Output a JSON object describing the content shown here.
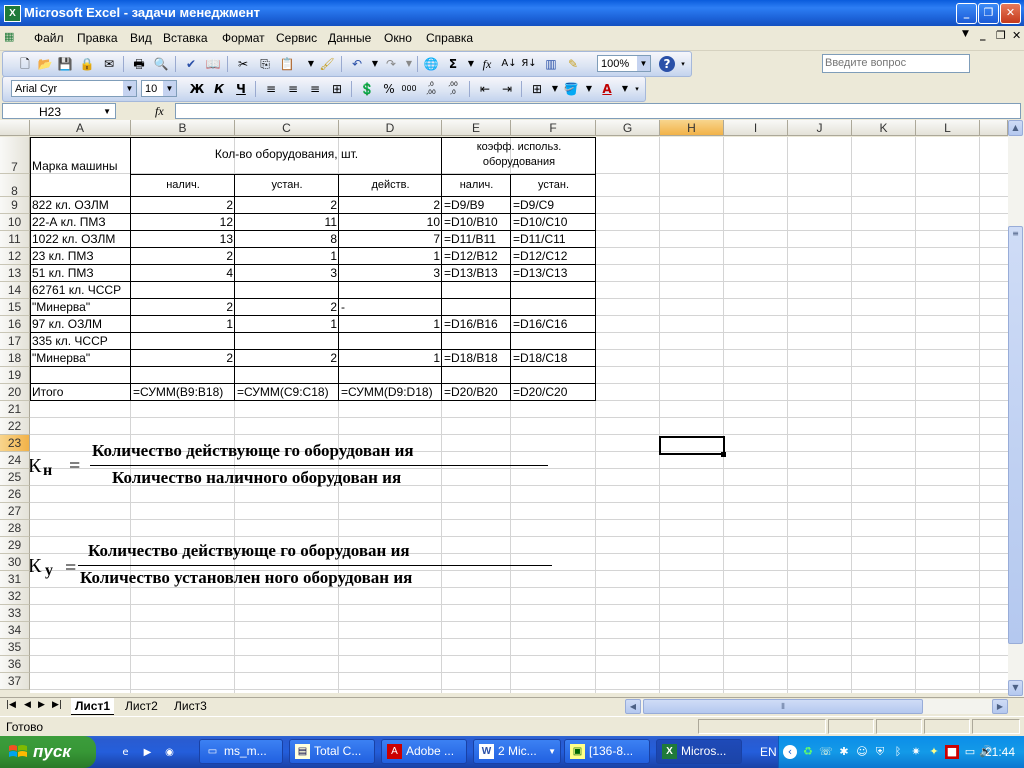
{
  "app": {
    "title": "Microsoft Excel - задачи менеджмент",
    "icon": "excel-icon"
  },
  "menu": [
    "Файл",
    "Правка",
    "Вид",
    "Вставка",
    "Формат",
    "Сервис",
    "Данные",
    "Окно",
    "Справка"
  ],
  "ask_placeholder": "Введите вопрос",
  "toolbar": {
    "zoom": "100%",
    "font_name": "Arial Cyr",
    "font_size": "10",
    "bold": "Ж",
    "italic": "К",
    "underline": "Ч",
    "percent": "%",
    "thousands": "000",
    "inc_decimal": ",0 ,00",
    "dec_decimal": ",00 ,0",
    "sum": "Σ",
    "fx": "fx",
    "help": "?"
  },
  "formula_bar": {
    "name_box": "H23",
    "fx_label": "fx",
    "formula": ""
  },
  "columns": [
    "A",
    "B",
    "C",
    "D",
    "E",
    "F",
    "G",
    "H",
    "I",
    "J",
    "K",
    "L"
  ],
  "selected_column": "H",
  "selected_row": "23",
  "rows": [
    "7",
    "8",
    "9",
    "10",
    "11",
    "12",
    "13",
    "14",
    "15",
    "16",
    "17",
    "18",
    "19",
    "20",
    "21",
    "22",
    "23",
    "24",
    "25",
    "26",
    "27",
    "28",
    "29",
    "30",
    "31",
    "32",
    "33",
    "34",
    "35",
    "36",
    "37"
  ],
  "table": {
    "header_a": "Марка машины",
    "header_bcd": "Кол-во оборудования, шт.",
    "header_ef_line1": "коэфф. использ.",
    "header_ef_line2": "оборудования",
    "sub_b": "налич.",
    "sub_c": "устан.",
    "sub_d": "действ.",
    "sub_e": "налич.",
    "sub_f": "устан.",
    "data_rows": [
      {
        "row": "9",
        "a": "822 кл. ОЗЛМ",
        "b": "2",
        "c": "2",
        "d": "2",
        "e": "=D9/B9",
        "f": "=D9/C9"
      },
      {
        "row": "10",
        "a": "22-А кл. ПМЗ",
        "b": "12",
        "c": "11",
        "d": "10",
        "e": "=D10/B10",
        "f": "=D10/C10"
      },
      {
        "row": "11",
        "a": "1022 кл. ОЗЛМ",
        "b": "13",
        "c": "8",
        "d": "7",
        "e": "=D11/B11",
        "f": "=D11/C11"
      },
      {
        "row": "12",
        "a": "23 кл. ПМЗ",
        "b": "2",
        "c": "1",
        "d": "1",
        "e": "=D12/B12",
        "f": "=D12/C12"
      },
      {
        "row": "13",
        "a": "51 кл. ПМЗ",
        "b": "4",
        "c": "3",
        "d": "3",
        "e": "=D13/B13",
        "f": "=D13/C13"
      },
      {
        "row": "14",
        "a": "62761 кл. ЧССР",
        "b": "",
        "c": "",
        "d": "",
        "e": "",
        "f": ""
      },
      {
        "row": "15",
        "a": "\"Минерва\"",
        "b": "2",
        "c": "2",
        "d": "-",
        "e": "",
        "f": ""
      },
      {
        "row": "16",
        "a": "97 кл. ОЗЛМ",
        "b": "1",
        "c": "1",
        "d": "1",
        "e": "=D16/B16",
        "f": "=D16/C16"
      },
      {
        "row": "17",
        "a": "335 кл. ЧССР",
        "b": "",
        "c": "",
        "d": "",
        "e": "",
        "f": ""
      },
      {
        "row": "18",
        "a": "\"Минерва\"",
        "b": "2",
        "c": "2",
        "d": "1",
        "e": "=D18/B18",
        "f": "=D18/C18"
      },
      {
        "row": "19",
        "a": "",
        "b": "",
        "c": "",
        "d": "",
        "e": "",
        "f": ""
      },
      {
        "row": "20",
        "a": "Итого",
        "b": "=СУММ(B9:B18)",
        "c": "=СУММ(C9:C18)",
        "d": "=СУММ(D9:D18)",
        "e": "=D20/B20",
        "f": "=D20/C20"
      }
    ]
  },
  "formula1": {
    "lhs": "К",
    "sub": "н",
    "eq": "=",
    "numerator": "Количество   действующе го  оборудован ия",
    "denominator": "Количество   наличного   оборудован ия"
  },
  "formula2": {
    "lhs": "К",
    "sub": "у",
    "eq": "=",
    "numerator": "Количество   действующе го  оборудован ия",
    "denominator": "Количество   установлен ного  оборудован ия"
  },
  "sheets": [
    "Лист1",
    "Лист2",
    "Лист3"
  ],
  "active_sheet": "Лист1",
  "status_text": "Готово",
  "taskbar": {
    "start": "пуск",
    "buttons": [
      "ms_m...",
      "Total C...",
      "Adobe ...",
      "2 Mic...",
      "[136-8...",
      "Micros..."
    ],
    "lang": "EN",
    "clock": "21:44"
  }
}
